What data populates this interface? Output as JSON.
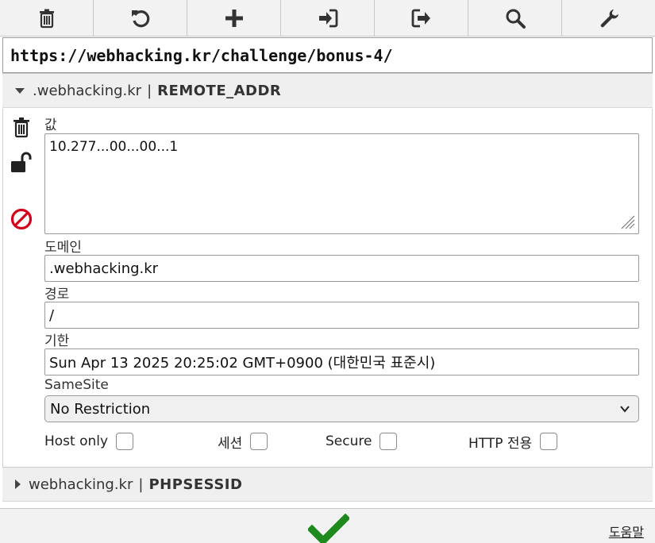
{
  "toolbar": {
    "buttons": [
      {
        "icon": "trash-icon",
        "action": "delete"
      },
      {
        "icon": "undo-icon",
        "action": "reset"
      },
      {
        "icon": "plus-icon",
        "action": "add"
      },
      {
        "icon": "import-icon",
        "action": "import"
      },
      {
        "icon": "export-icon",
        "action": "export"
      },
      {
        "icon": "search-icon",
        "action": "search"
      },
      {
        "icon": "wrench-icon",
        "action": "settings"
      }
    ]
  },
  "url": "https://webhacking.kr/challenge/bonus-4/",
  "cookies": [
    {
      "domain": ".webhacking.kr",
      "separator": "|",
      "name": "REMOTE_ADDR",
      "expanded": true
    },
    {
      "domain": "webhacking.kr",
      "separator": "|",
      "name": "PHPSESSID",
      "expanded": false
    }
  ],
  "detail": {
    "value_label": "값",
    "value": "10.277...00...00...1",
    "domain_label": "도메인",
    "domain": ".webhacking.kr",
    "path_label": "경로",
    "path": "/",
    "expires_label": "기한",
    "expires": "Sun Apr 13 2025 20:25:02 GMT+0900 (대한민국 표준시)",
    "samesite_label": "SameSite",
    "samesite": "No Restriction",
    "checkboxes": [
      {
        "label": "Host only",
        "checked": false
      },
      {
        "label": "세션",
        "checked": false
      },
      {
        "label": "Secure",
        "checked": false
      },
      {
        "label": "HTTP 전용",
        "checked": false
      }
    ]
  },
  "footer": {
    "help_label": "도움말"
  },
  "colors": {
    "ok_green": "#1e8a1e",
    "block_red": "#d0021b"
  }
}
